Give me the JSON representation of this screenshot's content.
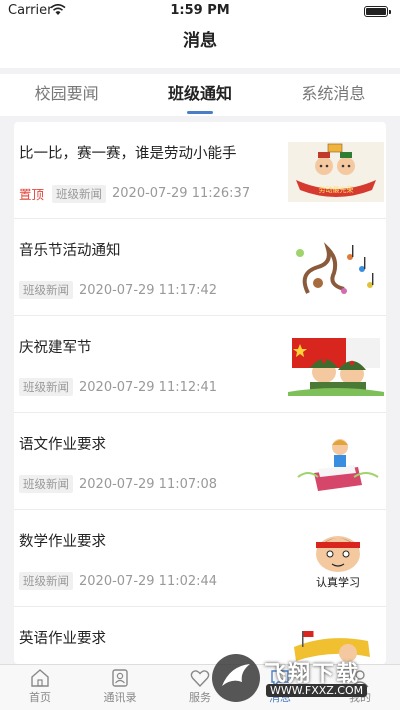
{
  "status_bar": {
    "carrier": "Carrier",
    "time": "1:59 PM"
  },
  "nav": {
    "title": "消息"
  },
  "tabs": [
    {
      "label": "校园要闻"
    },
    {
      "label": "班级通知"
    },
    {
      "label": "系统消息"
    }
  ],
  "messages": [
    {
      "title": "比一比，赛一赛，谁是劳动小能手",
      "pinned": "置顶",
      "tag": "班级新闻",
      "date": "2020-07-29 11:26:37",
      "thumb_icon": "labor-cartoon-thumbnail",
      "thumb_text": "劳动最光荣"
    },
    {
      "title": "音乐节活动通知",
      "tag": "班级新闻",
      "date": "2020-07-29 11:17:42",
      "thumb_icon": "music-notes-thumbnail"
    },
    {
      "title": "庆祝建军节",
      "tag": "班级新闻",
      "date": "2020-07-29 11:12:41",
      "thumb_icon": "soldiers-thumbnail"
    },
    {
      "title": "语文作业要求",
      "tag": "班级新闻",
      "date": "2020-07-29 11:07:08",
      "thumb_icon": "kid-reading-thumbnail"
    },
    {
      "title": "数学作业要求",
      "tag": "班级新闻",
      "date": "2020-07-29 11:02:44",
      "thumb_icon": "study-cartoon-thumbnail",
      "thumb_text": "认真学习"
    },
    {
      "title": "英语作业要求",
      "thumb_icon": "flag-cartoon-thumbnail"
    }
  ],
  "tabbar": [
    {
      "label": "首页",
      "icon": "home-icon"
    },
    {
      "label": "通讯录",
      "icon": "contacts-icon"
    },
    {
      "label": "服务",
      "icon": "heart-icon"
    },
    {
      "label": "消息",
      "icon": "message-icon"
    },
    {
      "label": "我的",
      "icon": "profile-icon"
    }
  ],
  "watermark": {
    "text": "飞翔下载",
    "url": "WWW.FXXZ.COM"
  },
  "colors": {
    "accent": "#4a7fc6",
    "pinned": "#e0463a"
  }
}
